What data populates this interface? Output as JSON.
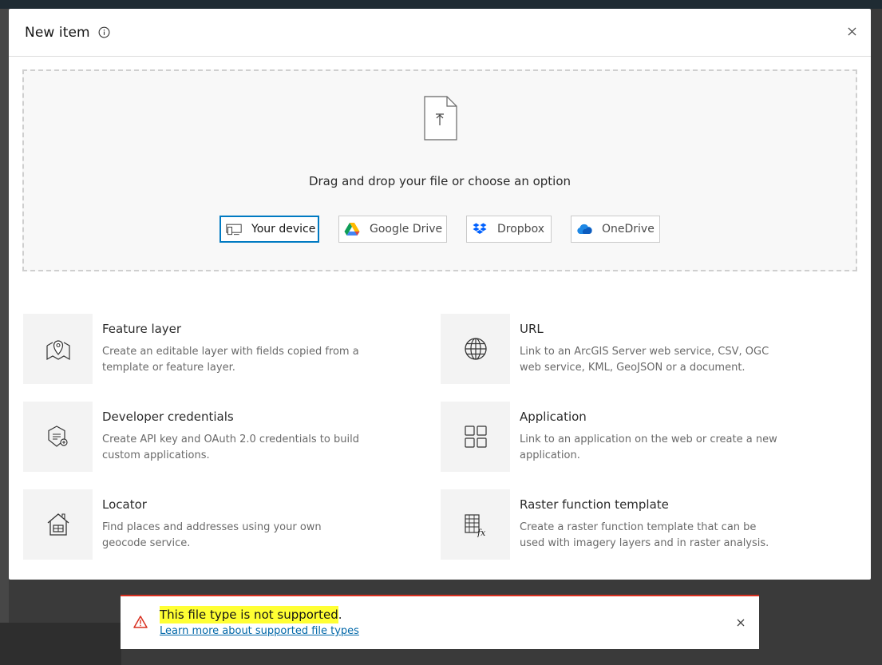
{
  "modal": {
    "title": "New item",
    "info_icon": "info-icon",
    "close_icon": "close-icon"
  },
  "dropzone": {
    "icon": "file-upload-icon",
    "prompt": "Drag and drop your file or choose an option",
    "sources": [
      {
        "label": "Your device",
        "icon": "device-icon",
        "selected": true
      },
      {
        "label": "Google Drive",
        "icon": "google-drive-icon",
        "selected": false
      },
      {
        "label": "Dropbox",
        "icon": "dropbox-icon",
        "selected": false
      },
      {
        "label": "OneDrive",
        "icon": "onedrive-icon",
        "selected": false
      }
    ]
  },
  "options": [
    {
      "title": "Feature layer",
      "desc": "Create an editable layer with fields copied from a template or feature layer.",
      "icon": "map-pin-icon"
    },
    {
      "title": "URL",
      "desc": "Link to an ArcGIS Server web service, CSV, OGC web service, KML, GeoJSON or a document.",
      "icon": "globe-icon"
    },
    {
      "title": "Developer credentials",
      "desc": "Create API key and OAuth 2.0 credentials to build custom applications.",
      "icon": "credentials-icon"
    },
    {
      "title": "Application",
      "desc": "Link to an application on the web or create a new application.",
      "icon": "apps-grid-icon"
    },
    {
      "title": "Locator",
      "desc": "Find places and addresses using your own geocode service.",
      "icon": "house-icon"
    },
    {
      "title": "Raster function template",
      "desc": "Create a raster function template that can be used with imagery layers and in raster analysis.",
      "icon": "raster-function-icon"
    }
  ],
  "toast": {
    "message": "This file type is not supported",
    "message_end": ".",
    "link": "Learn more about supported file types",
    "warning_icon": "warning-icon",
    "close_icon": "close-icon"
  },
  "colors": {
    "accent": "#007ac2",
    "error": "#d83020",
    "highlight": "#ffff33"
  }
}
